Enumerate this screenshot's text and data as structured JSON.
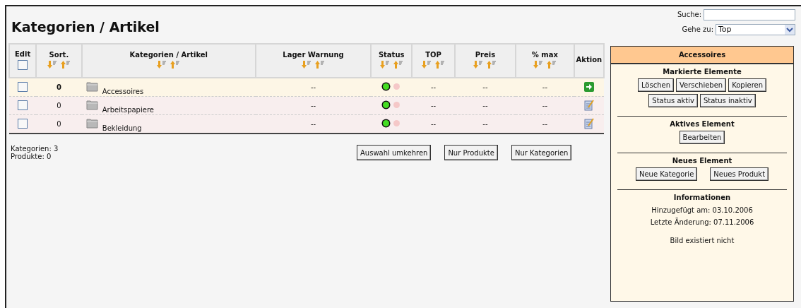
{
  "title": "Kategorien / Artikel",
  "search": {
    "label": "Suche:"
  },
  "goto": {
    "label": "Gehe zu:",
    "value": "Top"
  },
  "table": {
    "select_all_checked": false,
    "columns": [
      {
        "label": "Edit",
        "kind": "checkbox"
      },
      {
        "label": "Sort.",
        "kind": "sortable"
      },
      {
        "label": "Kategorien / Artikel",
        "kind": "sortable"
      },
      {
        "label": "Lager Warnung",
        "kind": "sortable"
      },
      {
        "label": "Status",
        "kind": "sortable"
      },
      {
        "label": "TOP",
        "kind": "sortable"
      },
      {
        "label": "Preis",
        "kind": "sortable"
      },
      {
        "label": "% max",
        "kind": "sortable"
      },
      {
        "label": "Aktion",
        "kind": "plain"
      }
    ],
    "rows": [
      {
        "selected": true,
        "checked": false,
        "sort": "0",
        "name": "Accessoires",
        "lager": "--",
        "active": true,
        "top": "--",
        "preis": "--",
        "max": "--"
      },
      {
        "selected": false,
        "checked": false,
        "sort": "0",
        "name": "Arbeitspapiere",
        "lager": "--",
        "active": true,
        "top": "--",
        "preis": "--",
        "max": "--"
      },
      {
        "selected": false,
        "checked": false,
        "sort": "0",
        "name": "Bekleidung",
        "lager": "--",
        "active": true,
        "top": "--",
        "preis": "--",
        "max": "--"
      }
    ]
  },
  "summary": [
    "Kategorien: 3",
    "Produkte: 0"
  ],
  "buttons": [
    "Auswahl umkehren",
    "Nur Produkte",
    "Nur Kategorien"
  ],
  "panel": {
    "title": "Accessoires",
    "sections": [
      {
        "heading": "Markierte Elemente",
        "buttons": [
          "Löschen",
          "Verschieben",
          "Kopieren",
          "Status aktiv",
          "Status inaktiv"
        ]
      },
      {
        "heading": "Aktives Element",
        "buttons": [
          "Bearbeiten"
        ]
      },
      {
        "heading": "Neues Element",
        "buttons": [
          "Neue Kategorie",
          "Neues Produkt"
        ]
      }
    ],
    "info": {
      "heading": "Informationen",
      "lines": [
        "Hinzugefügt am: 03.10.2006",
        "Letzte Änderung: 07.11.2006"
      ],
      "note": "Bild existiert nicht"
    }
  }
}
